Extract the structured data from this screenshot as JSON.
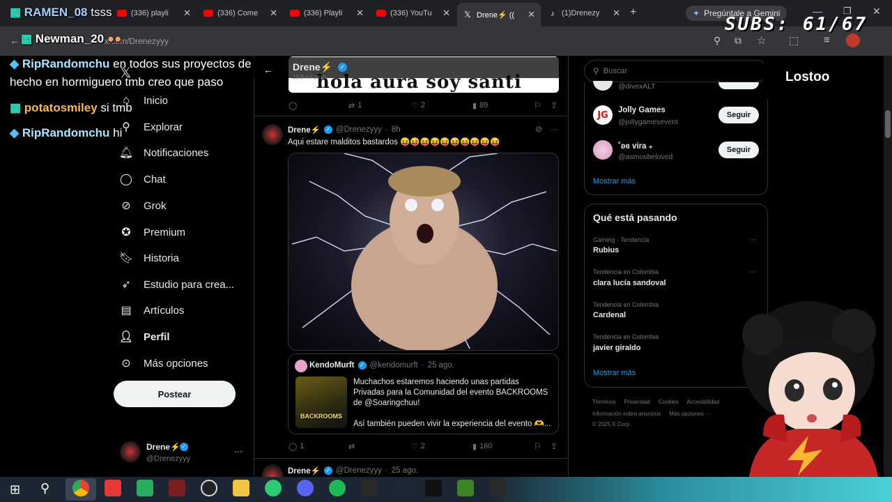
{
  "browser": {
    "tabs": [
      {
        "label": "(336) playli"
      },
      {
        "label": "(336) Come"
      },
      {
        "label": "(336) Playli"
      },
      {
        "label": "(336) YouTu"
      },
      {
        "label": "Drene⚡ (("
      },
      {
        "label": "(1)Drenezy"
      }
    ],
    "gemini_label": "Pregúntale a Gemini",
    "address": "x.com/Drenezyyy"
  },
  "overlay": {
    "subs": "SUBS: 61/67",
    "streamer_name": "Lostoo",
    "chat": [
      {
        "user": "RAMEN_08",
        "msg": "tsss"
      },
      {
        "user": "Newman_20",
        "msg": ""
      },
      {
        "user": "RipRandomchu",
        "msg": "en todos sus proyectos de"
      },
      {
        "user": "",
        "msg": "hecho en hormiguero tmb creo que paso"
      },
      {
        "user": "potatosmiley",
        "msg": "si tmb"
      },
      {
        "user": "RipRandomchu",
        "msg": "hi"
      }
    ]
  },
  "nav": {
    "items": [
      "Inicio",
      "Explorar",
      "Notificaciones",
      "Chat",
      "Grok",
      "Premium",
      "Historia",
      "Estudio para crea...",
      "Artículos",
      "Perfil",
      "Más opciones"
    ],
    "post_button": "Postear",
    "account_name": "Drene⚡",
    "account_handle": "@Drenezyyy"
  },
  "profile_header": {
    "name": "Drene⚡",
    "posts": "19,8 mil posts",
    "banner_text": "hola aura soy santi"
  },
  "tweets": {
    "prev_stats": {
      "replies": "",
      "reposts": "1",
      "likes": "2",
      "views": "89"
    },
    "main": {
      "name": "Drene⚡",
      "handle": "@Drenezyyy",
      "time": "8h",
      "text": "Aqui estare malditos bastardos 😝😝😝😝😝😝😝😝😝😝",
      "quote": {
        "name": "KendoMurft",
        "handle": "@kendomurft",
        "time": "25 ago.",
        "text": "Muchachos estaremos haciendo unas partidas Privadas para la Comunidad del evento BACKROOMS de @Soaringchuu!",
        "text2": "Así también pueden vivir la experiencia del evento 🫶...",
        "thumb_label": "BACKROOMS"
      },
      "stats": {
        "replies": "1",
        "reposts": "",
        "likes": "2",
        "views": "160"
      }
    },
    "next": {
      "name": "Drene⚡",
      "handle": "@Drenezyyy",
      "time": "25 ago."
    }
  },
  "right": {
    "search_placeholder": "Buscar",
    "follow": [
      {
        "name": "",
        "handle": "@divexALT",
        "button": ""
      },
      {
        "name": "Jolly Games",
        "handle": "@jollygamesevent",
        "button": "Seguir"
      },
      {
        "name": "˚ʚɞ vira ₊",
        "handle": "@asmosbeloved",
        "button": "Seguir"
      }
    ],
    "show_more": "Mostrar más",
    "trends_title": "Qué está pasando",
    "trends": [
      {
        "context": "Gaming · Tendencia",
        "name": "Rubius"
      },
      {
        "context": "Tendencia en Colombia",
        "name": "clara lucía sandoval"
      },
      {
        "context": "Tendencia en Colombia",
        "name": "Cardenal"
      },
      {
        "context": "Tendencia en Colombia",
        "name": "javier giraldo"
      }
    ],
    "trends_more": "Mostrar más",
    "footer1": [
      "Términos",
      "Privacidad",
      "Cookies",
      "Accesibilidad"
    ],
    "footer2": [
      "Información sobre anuncios",
      "Más opciones ···"
    ],
    "copyright": "© 2025 X Corp."
  },
  "colors": {
    "accent": "#1d9bf0",
    "bg": "#000000",
    "border": "#2f3336"
  }
}
